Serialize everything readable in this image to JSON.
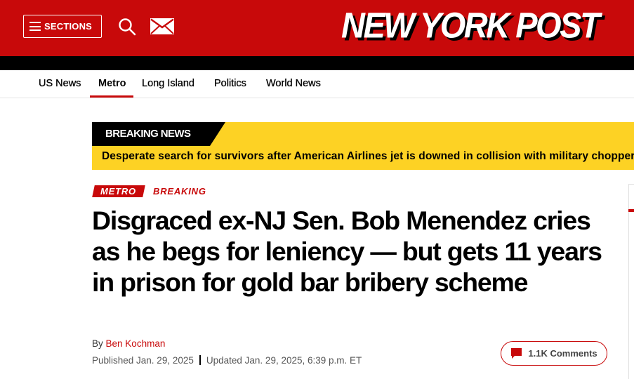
{
  "header": {
    "sections_label": "SECTIONS",
    "logo_text": "NEW YORK POST",
    "icons": {
      "menu": "hamburger-icon",
      "search": "search-icon",
      "mail": "mail-icon"
    }
  },
  "nav": {
    "items": [
      {
        "label": "US News",
        "active": false
      },
      {
        "label": "Metro",
        "active": true
      },
      {
        "label": "Long Island",
        "active": false
      },
      {
        "label": "Politics",
        "active": false
      },
      {
        "label": "World News",
        "active": false
      }
    ]
  },
  "breaking": {
    "tag": "BREAKING NEWS",
    "text": "Desperate search for survivors after American Airlines jet is downed in collision with military chopper"
  },
  "article": {
    "section_tag": "METRO",
    "breaking_tag": "BREAKING",
    "headline": "Disgraced ex-NJ Sen. Bob Menendez cries as he begs for leniency — but gets 11 years in prison for gold bar bribery scheme",
    "by_prefix": "By",
    "author": "Ben Kochman",
    "published": "Published Jan. 29, 2025",
    "updated": "Updated Jan. 29, 2025, 6:39 p.m. ET",
    "comments_label": "1.1K Comments"
  },
  "colors": {
    "brand_red": "#c8090a",
    "breaking_yellow": "#fdd224",
    "black": "#000000"
  }
}
